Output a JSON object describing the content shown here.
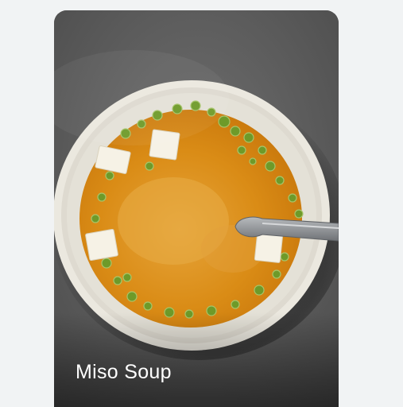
{
  "card": {
    "title": "Miso Soup",
    "image": {
      "subject": "miso-soup-bowl",
      "colors": {
        "background": "#5b5b5b",
        "bowl": "#e9e6dc",
        "broth": "#d98a12",
        "broth_center": "#e2a234",
        "scallion": "#6f9b2a",
        "tofu": "#f5f1e4",
        "spoon": "#8c8f94"
      }
    }
  }
}
